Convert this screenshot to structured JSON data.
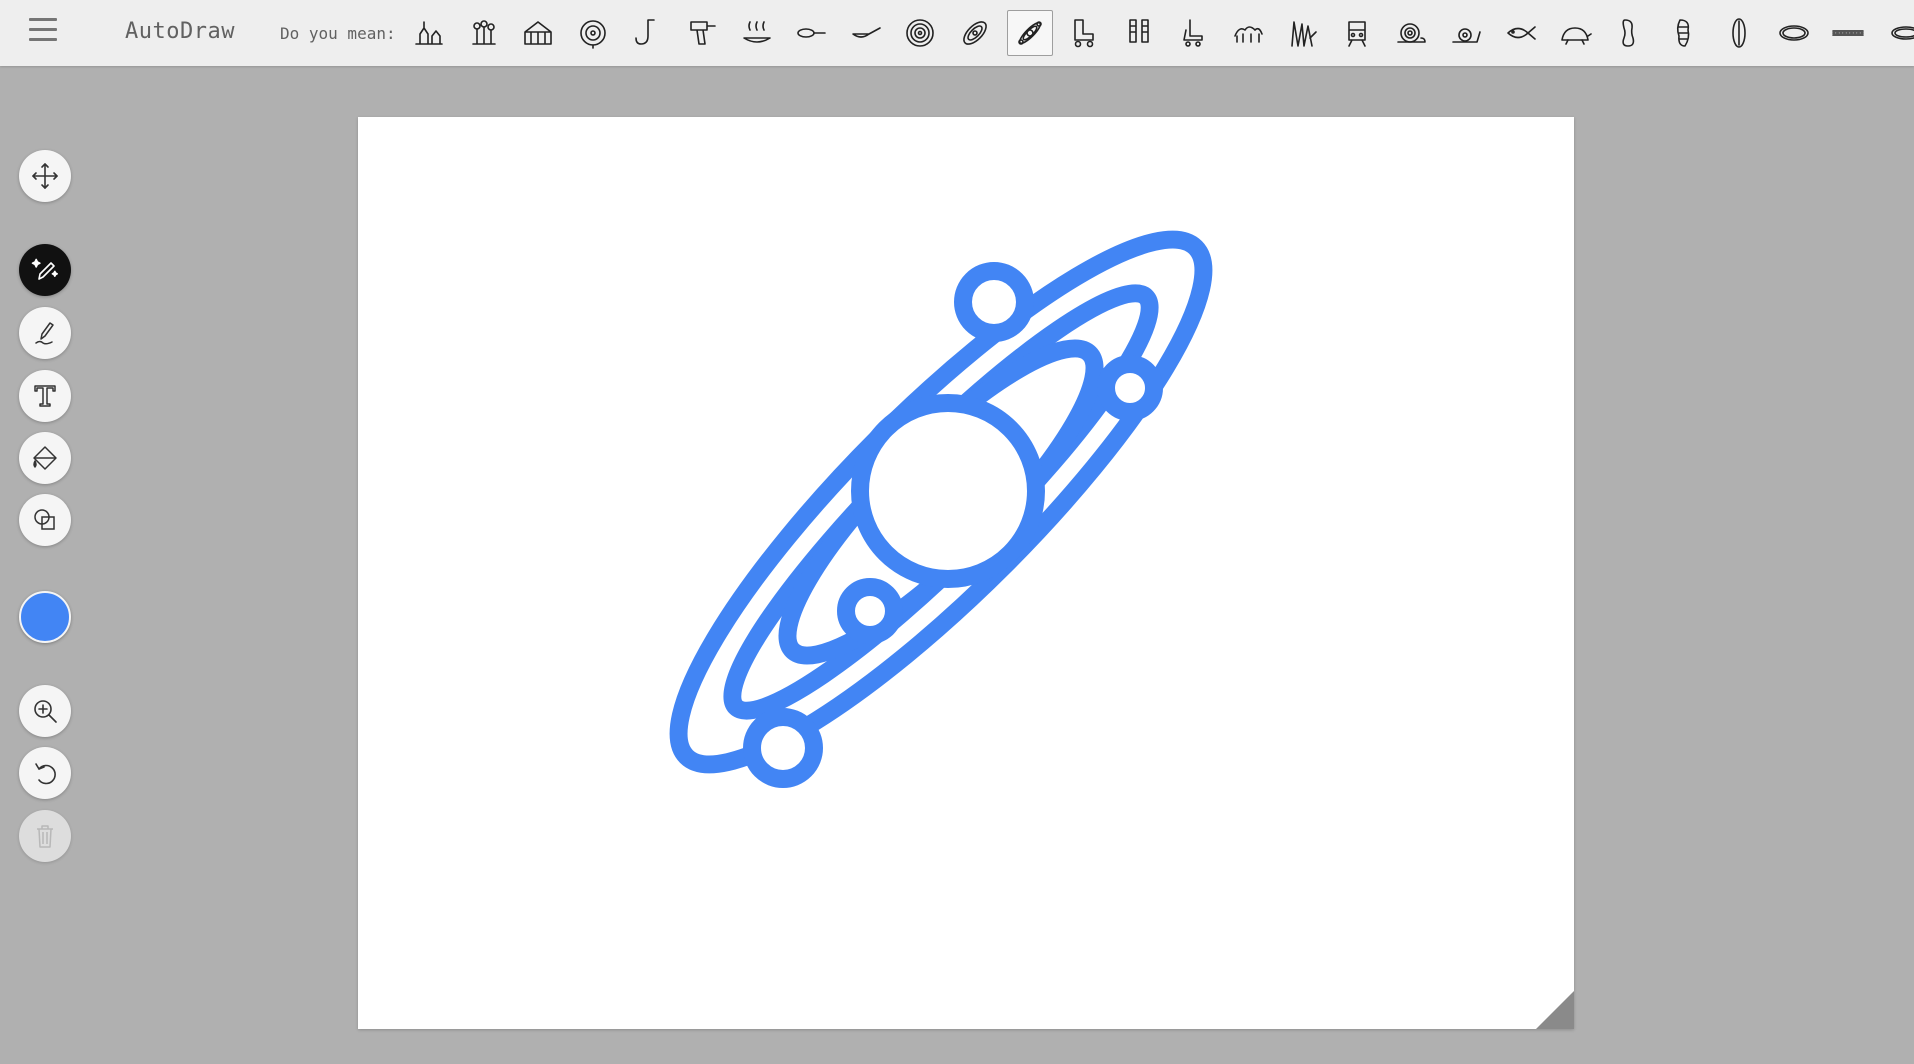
{
  "app": {
    "title": "AutoDraw"
  },
  "suggestions": {
    "label": "Do you mean:",
    "items": [
      {
        "icon": "camp-icon"
      },
      {
        "icon": "flowers-icon"
      },
      {
        "icon": "greenhouse-icon"
      },
      {
        "icon": "target-icon"
      },
      {
        "icon": "hook-icon"
      },
      {
        "icon": "drill-icon"
      },
      {
        "icon": "hot-pan-icon"
      },
      {
        "icon": "pan-icon"
      },
      {
        "icon": "frying-pan-icon"
      },
      {
        "icon": "vinyl-record-icon"
      },
      {
        "icon": "galaxy-icon"
      },
      {
        "icon": "solar-system-icon",
        "selected": true
      },
      {
        "icon": "roller-skate-icon"
      },
      {
        "icon": "boots-icon"
      },
      {
        "icon": "skate-icon"
      },
      {
        "icon": "animals-icon"
      },
      {
        "icon": "grass-icon"
      },
      {
        "icon": "train-icon"
      },
      {
        "icon": "snail-icon"
      },
      {
        "icon": "snail-small-icon"
      },
      {
        "icon": "fish-icon"
      },
      {
        "icon": "turtle-icon"
      },
      {
        "icon": "peanut-icon"
      },
      {
        "icon": "peanut-shell-icon"
      },
      {
        "icon": "bean-icon"
      },
      {
        "icon": "ring-icon"
      },
      {
        "icon": "chain-icon"
      },
      {
        "icon": "oval-ring-icon"
      }
    ]
  },
  "tools": [
    {
      "name": "move-tool",
      "icon": "move-icon"
    },
    {
      "name": "autodraw-tool",
      "icon": "autodraw-icon",
      "active": true
    },
    {
      "name": "draw-tool",
      "icon": "pencil-icon"
    },
    {
      "name": "type-tool",
      "icon": "text-icon"
    },
    {
      "name": "fill-tool",
      "icon": "paint-bucket-icon"
    },
    {
      "name": "shape-tool",
      "icon": "shapes-icon"
    },
    {
      "name": "zoom-tool",
      "icon": "zoom-in-icon"
    },
    {
      "name": "undo-tool",
      "icon": "undo-icon"
    },
    {
      "name": "delete-tool",
      "icon": "trash-icon",
      "disabled": true
    }
  ],
  "colors": {
    "current": "#4285f4",
    "active_tool_bg": "#111111"
  }
}
